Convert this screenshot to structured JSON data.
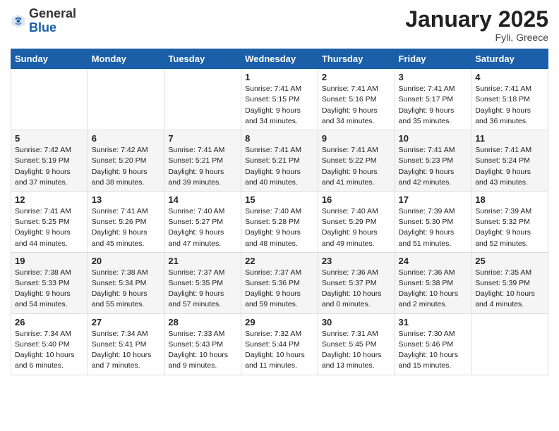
{
  "header": {
    "logo_general": "General",
    "logo_blue": "Blue",
    "month": "January 2025",
    "location": "Fyli, Greece"
  },
  "weekdays": [
    "Sunday",
    "Monday",
    "Tuesday",
    "Wednesday",
    "Thursday",
    "Friday",
    "Saturday"
  ],
  "weeks": [
    [
      {
        "day": "",
        "info": ""
      },
      {
        "day": "",
        "info": ""
      },
      {
        "day": "",
        "info": ""
      },
      {
        "day": "1",
        "info": "Sunrise: 7:41 AM\nSunset: 5:15 PM\nDaylight: 9 hours\nand 34 minutes."
      },
      {
        "day": "2",
        "info": "Sunrise: 7:41 AM\nSunset: 5:16 PM\nDaylight: 9 hours\nand 34 minutes."
      },
      {
        "day": "3",
        "info": "Sunrise: 7:41 AM\nSunset: 5:17 PM\nDaylight: 9 hours\nand 35 minutes."
      },
      {
        "day": "4",
        "info": "Sunrise: 7:41 AM\nSunset: 5:18 PM\nDaylight: 9 hours\nand 36 minutes."
      }
    ],
    [
      {
        "day": "5",
        "info": "Sunrise: 7:42 AM\nSunset: 5:19 PM\nDaylight: 9 hours\nand 37 minutes."
      },
      {
        "day": "6",
        "info": "Sunrise: 7:42 AM\nSunset: 5:20 PM\nDaylight: 9 hours\nand 38 minutes."
      },
      {
        "day": "7",
        "info": "Sunrise: 7:41 AM\nSunset: 5:21 PM\nDaylight: 9 hours\nand 39 minutes."
      },
      {
        "day": "8",
        "info": "Sunrise: 7:41 AM\nSunset: 5:21 PM\nDaylight: 9 hours\nand 40 minutes."
      },
      {
        "day": "9",
        "info": "Sunrise: 7:41 AM\nSunset: 5:22 PM\nDaylight: 9 hours\nand 41 minutes."
      },
      {
        "day": "10",
        "info": "Sunrise: 7:41 AM\nSunset: 5:23 PM\nDaylight: 9 hours\nand 42 minutes."
      },
      {
        "day": "11",
        "info": "Sunrise: 7:41 AM\nSunset: 5:24 PM\nDaylight: 9 hours\nand 43 minutes."
      }
    ],
    [
      {
        "day": "12",
        "info": "Sunrise: 7:41 AM\nSunset: 5:25 PM\nDaylight: 9 hours\nand 44 minutes."
      },
      {
        "day": "13",
        "info": "Sunrise: 7:41 AM\nSunset: 5:26 PM\nDaylight: 9 hours\nand 45 minutes."
      },
      {
        "day": "14",
        "info": "Sunrise: 7:40 AM\nSunset: 5:27 PM\nDaylight: 9 hours\nand 47 minutes."
      },
      {
        "day": "15",
        "info": "Sunrise: 7:40 AM\nSunset: 5:28 PM\nDaylight: 9 hours\nand 48 minutes."
      },
      {
        "day": "16",
        "info": "Sunrise: 7:40 AM\nSunset: 5:29 PM\nDaylight: 9 hours\nand 49 minutes."
      },
      {
        "day": "17",
        "info": "Sunrise: 7:39 AM\nSunset: 5:30 PM\nDaylight: 9 hours\nand 51 minutes."
      },
      {
        "day": "18",
        "info": "Sunrise: 7:39 AM\nSunset: 5:32 PM\nDaylight: 9 hours\nand 52 minutes."
      }
    ],
    [
      {
        "day": "19",
        "info": "Sunrise: 7:38 AM\nSunset: 5:33 PM\nDaylight: 9 hours\nand 54 minutes."
      },
      {
        "day": "20",
        "info": "Sunrise: 7:38 AM\nSunset: 5:34 PM\nDaylight: 9 hours\nand 55 minutes."
      },
      {
        "day": "21",
        "info": "Sunrise: 7:37 AM\nSunset: 5:35 PM\nDaylight: 9 hours\nand 57 minutes."
      },
      {
        "day": "22",
        "info": "Sunrise: 7:37 AM\nSunset: 5:36 PM\nDaylight: 9 hours\nand 59 minutes."
      },
      {
        "day": "23",
        "info": "Sunrise: 7:36 AM\nSunset: 5:37 PM\nDaylight: 10 hours\nand 0 minutes."
      },
      {
        "day": "24",
        "info": "Sunrise: 7:36 AM\nSunset: 5:38 PM\nDaylight: 10 hours\nand 2 minutes."
      },
      {
        "day": "25",
        "info": "Sunrise: 7:35 AM\nSunset: 5:39 PM\nDaylight: 10 hours\nand 4 minutes."
      }
    ],
    [
      {
        "day": "26",
        "info": "Sunrise: 7:34 AM\nSunset: 5:40 PM\nDaylight: 10 hours\nand 6 minutes."
      },
      {
        "day": "27",
        "info": "Sunrise: 7:34 AM\nSunset: 5:41 PM\nDaylight: 10 hours\nand 7 minutes."
      },
      {
        "day": "28",
        "info": "Sunrise: 7:33 AM\nSunset: 5:43 PM\nDaylight: 10 hours\nand 9 minutes."
      },
      {
        "day": "29",
        "info": "Sunrise: 7:32 AM\nSunset: 5:44 PM\nDaylight: 10 hours\nand 11 minutes."
      },
      {
        "day": "30",
        "info": "Sunrise: 7:31 AM\nSunset: 5:45 PM\nDaylight: 10 hours\nand 13 minutes."
      },
      {
        "day": "31",
        "info": "Sunrise: 7:30 AM\nSunset: 5:46 PM\nDaylight: 10 hours\nand 15 minutes."
      },
      {
        "day": "",
        "info": ""
      }
    ]
  ]
}
